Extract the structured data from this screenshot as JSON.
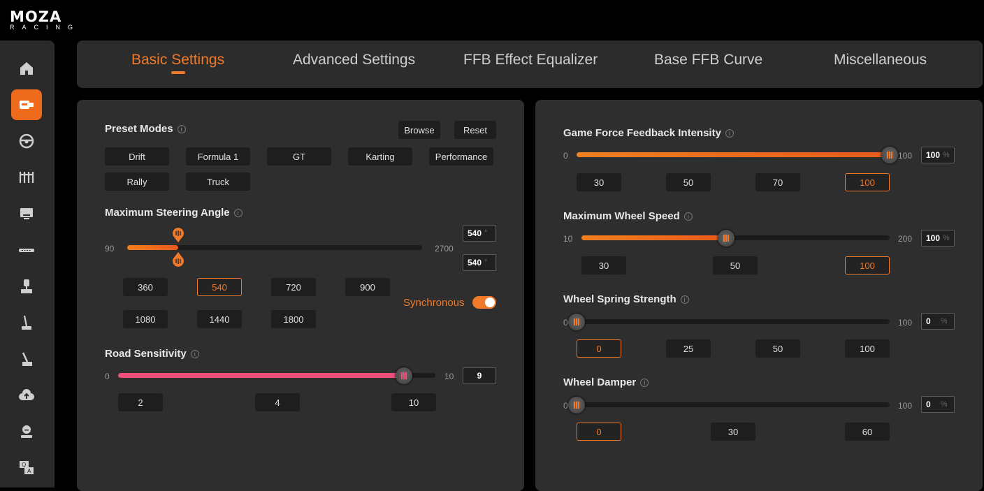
{
  "brand": {
    "name": "MOZA",
    "sub": "RACING"
  },
  "sidebar": {
    "items": [
      "home",
      "motor",
      "wheel",
      "pedals",
      "dashboard",
      "shifter-bar",
      "joystick",
      "handbrake",
      "handbrake-2",
      "cloud",
      "user",
      "qa"
    ]
  },
  "tabs": [
    "Basic Settings",
    "Advanced Settings",
    "FFB Effect Equalizer",
    "Base FFB Curve",
    "Miscellaneous"
  ],
  "left": {
    "preset": {
      "title": "Preset Modes",
      "browse": "Browse",
      "reset": "Reset",
      "modes": [
        "Drift",
        "Formula 1",
        "GT",
        "Karting",
        "Performance",
        "Rally",
        "Truck"
      ]
    },
    "steering": {
      "title": "Maximum Steering Angle",
      "min": "90",
      "max": "2700",
      "value_top": "540",
      "value_bottom": "540",
      "unit": "°",
      "level": 0.172,
      "presets": [
        "360",
        "540",
        "720",
        "900",
        "1080",
        "1440",
        "1800"
      ],
      "sync_label": "Synchronous"
    },
    "road": {
      "title": "Road Sensitivity",
      "min": "0",
      "max": "10",
      "value": "9",
      "level": 0.9,
      "presets": [
        "2",
        "4",
        "10"
      ]
    }
  },
  "right": {
    "ffb": {
      "title": "Game Force Feedback Intensity",
      "min": "0",
      "max": "100",
      "value": "100",
      "unit": "%",
      "level": 1.0,
      "presets": [
        "30",
        "50",
        "70",
        "100"
      ]
    },
    "speed": {
      "title": "Maximum Wheel Speed",
      "min": "10",
      "max": "200",
      "value": "100",
      "unit": "%",
      "level": 0.47,
      "presets": [
        "30",
        "50",
        "100"
      ]
    },
    "spring": {
      "title": "Wheel Spring Strength",
      "min": "0",
      "max": "100",
      "value": "0",
      "unit": "%",
      "level": 0.0,
      "presets": [
        "0",
        "25",
        "50",
        "100"
      ]
    },
    "damper": {
      "title": "Wheel Damper",
      "min": "0",
      "max": "100",
      "value": "0",
      "unit": "%",
      "level": 0.0,
      "presets": [
        "0",
        "30",
        "60"
      ]
    }
  },
  "colors": {
    "accent": "#f07a2a",
    "pink": "#ef4f7a",
    "panel": "#2e2e2e"
  }
}
